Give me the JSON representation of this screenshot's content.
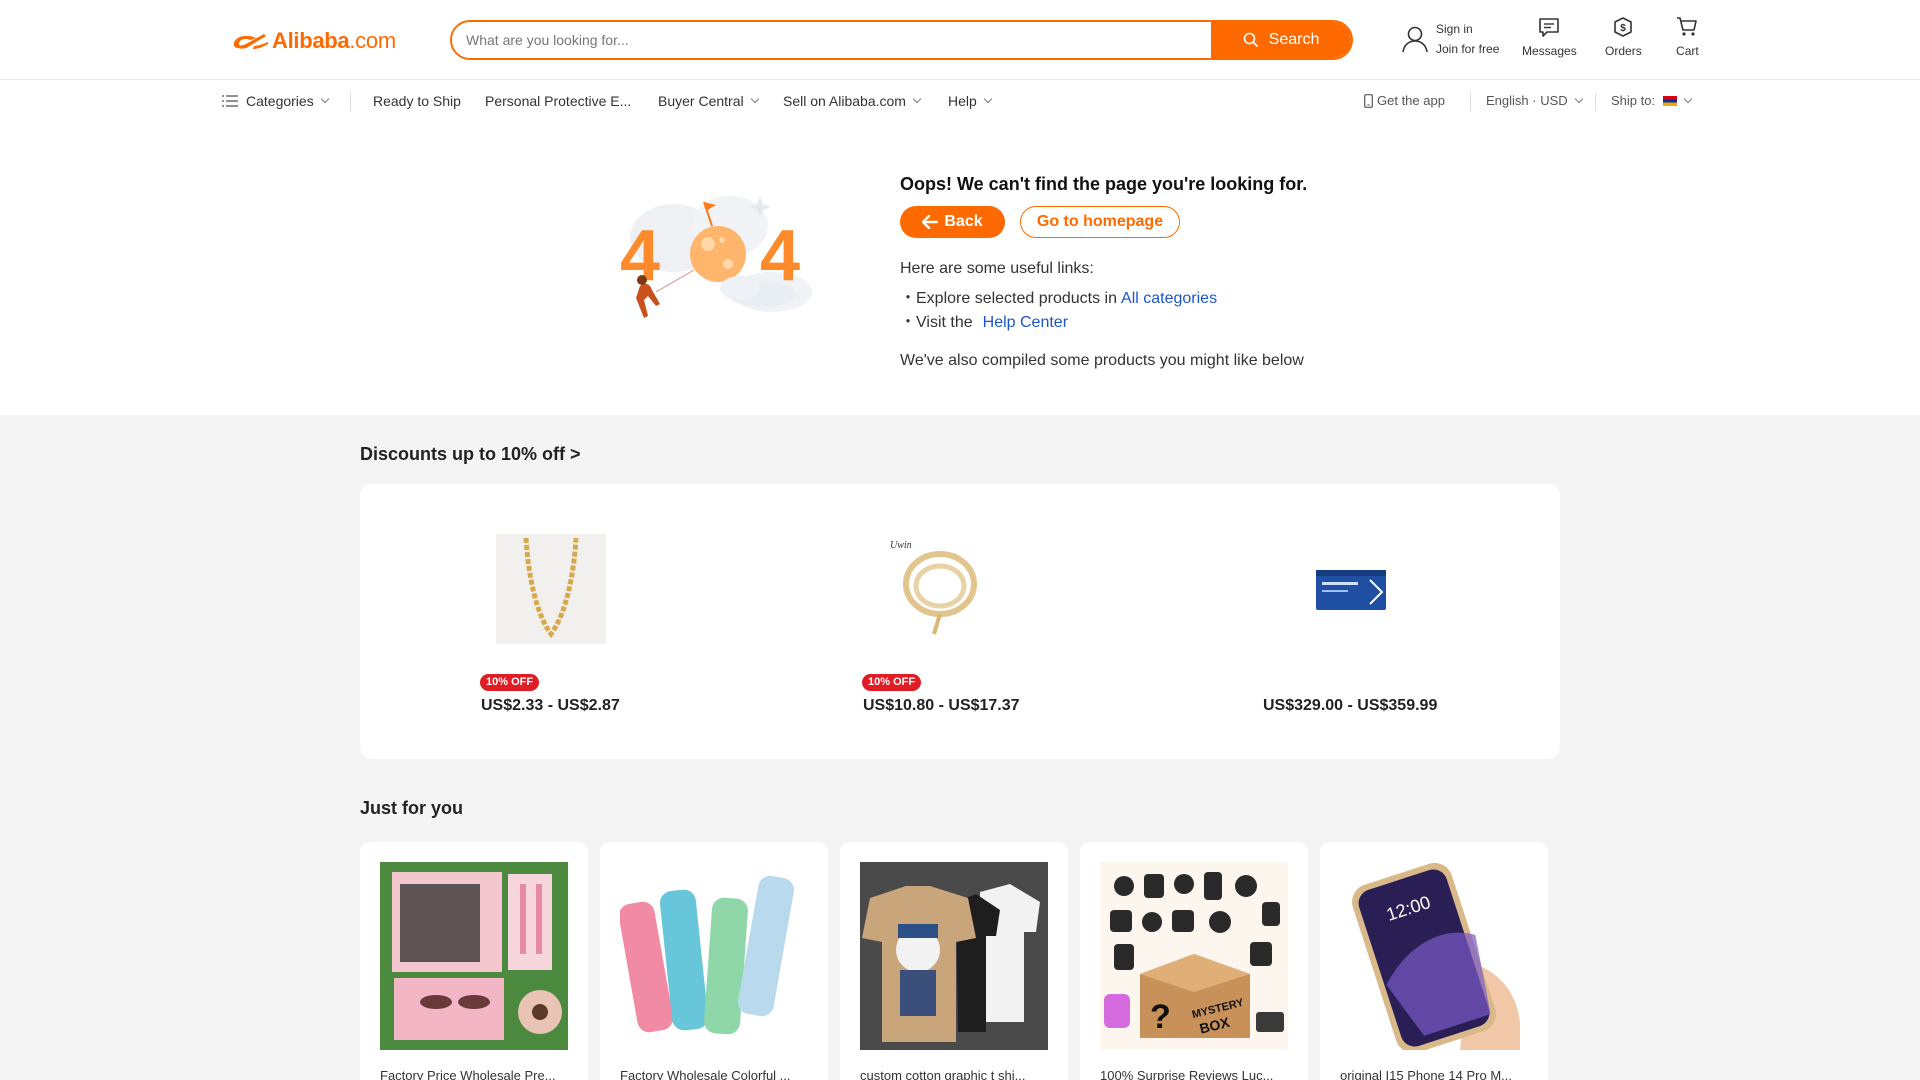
{
  "header": {
    "logo_text": "Alibaba",
    "logo_suffix": ".com",
    "search_placeholder": "What are you looking for...",
    "search_button": "Search",
    "sign_in": "Sign in",
    "join": "Join for free",
    "messages": "Messages",
    "orders": "Orders",
    "cart": "Cart"
  },
  "subnav": {
    "categories": "Categories",
    "ready_to_ship": "Ready to Ship",
    "ppe": "Personal Protective E...",
    "buyer_central": "Buyer Central",
    "sell": "Sell on Alibaba.com",
    "help": "Help",
    "get_app": "Get the app",
    "language": "English · USD",
    "ship_to": "Ship to:"
  },
  "error": {
    "title": "Oops! We can't find the page you're looking for.",
    "back": "Back",
    "home": "Go to homepage",
    "links_intro": "Here are some useful links:",
    "explore_prefix": "・Explore selected products in",
    "explore_link": "All categories",
    "visit_prefix": "・Visit the",
    "visit_link": "Help Center",
    "compiled": "We've also compiled some products you might like below",
    "illus_number": "404"
  },
  "deals": {
    "title": "Discounts up to 10%  off >",
    "items": [
      {
        "badge": "10% OFF",
        "price": "US$2.33 - US$2.87"
      },
      {
        "badge": "10% OFF",
        "price": "US$10.80 - US$17.37"
      },
      {
        "badge": "",
        "price": "US$329.00 - US$359.99"
      }
    ]
  },
  "just_for_you": {
    "title": "Just for you",
    "items": [
      {
        "title": "Factory Price Wholesale Pre..."
      },
      {
        "title": "Factory Wholesale Colorful ..."
      },
      {
        "title": "custom cotton graphic t shi..."
      },
      {
        "title": "100% Surprise Reviews Luc..."
      },
      {
        "title": "original I15 Phone 14 Pro M..."
      }
    ]
  },
  "colors": {
    "accent": "#ff6a00",
    "link": "#1b56c9",
    "badge": "#e01d25",
    "grey_bg": "#f4f4f4"
  }
}
